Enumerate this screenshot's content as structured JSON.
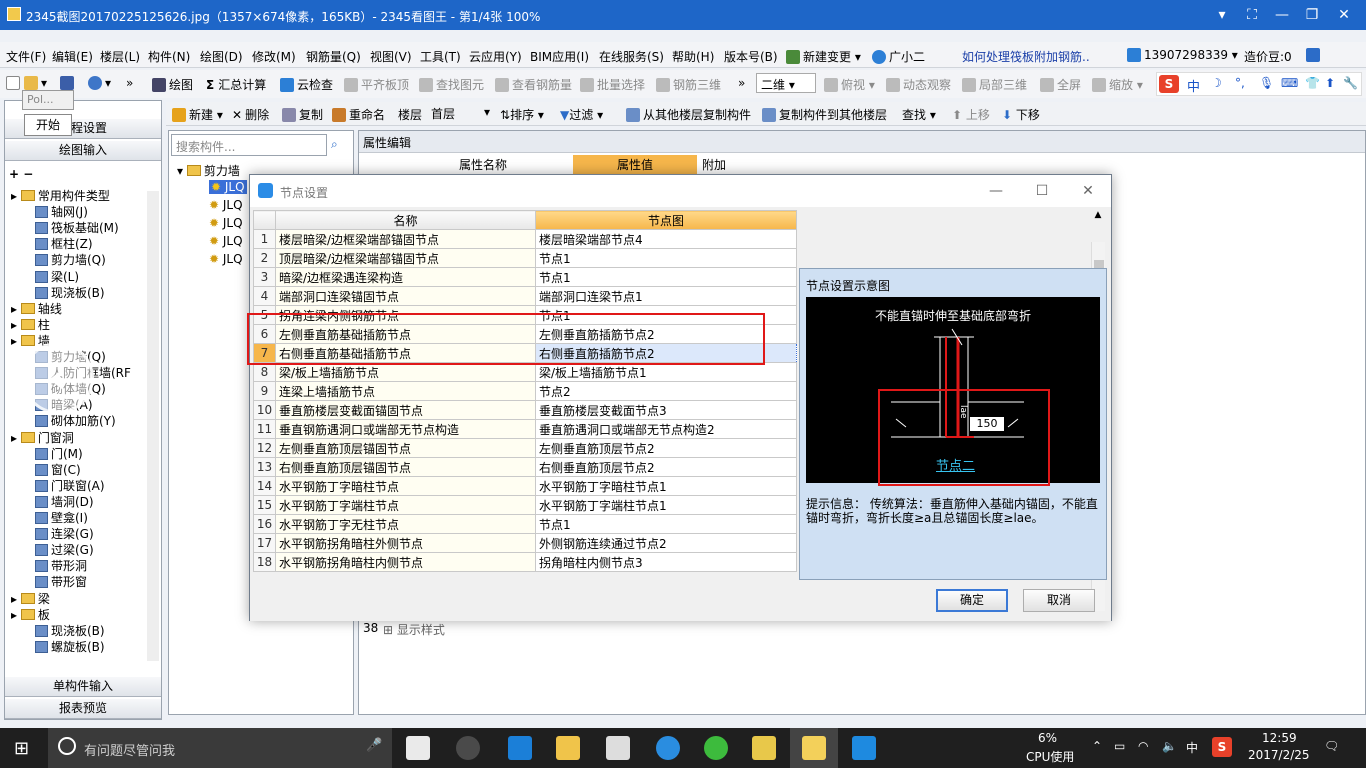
{
  "window": {
    "title": "2345截图20170225125626.jpg（1357×674像素，165KB）- 2345看图王 - 第1/4张 100%"
  },
  "menubar": {
    "items": [
      "文件(F)",
      "编辑(E)",
      "楼层(L)",
      "构件(N)",
      "绘图(D)",
      "修改(M)",
      "钢筋量(Q)",
      "视图(V)",
      "工具(T)",
      "云应用(Y)",
      "BIM应用(I)",
      "在线服务(S)",
      "帮助(H)",
      "版本号(B)"
    ],
    "new_change": "新建变更",
    "assistant": "广小二",
    "help_link": "如何处理筏板附加钢筋..",
    "phone": "13907298339",
    "price": "造价豆:0"
  },
  "toolbar1": {
    "draw": "绘图",
    "sum": "汇总计算",
    "cloud_check": "云检查",
    "flat_top": "平齐板顶",
    "find_element": "查找图元",
    "view_rebar": "查看钢筋量",
    "batch_select": "批量选择",
    "rebar_3d": "钢筋三维",
    "view_mode": "二维",
    "top_view": "俯视",
    "dynamic_view": "动态观察",
    "local_3d": "局部三维",
    "fullscreen": "全屏",
    "zoom": "缩放"
  },
  "toolbar2": {
    "new": "新建",
    "delete": "删除",
    "copy": "复制",
    "rename": "重命名",
    "floor_label": "楼层",
    "floor_value": "首层",
    "sort": "排序",
    "filter": "过滤",
    "copy_from": "从其他楼层复制构件",
    "copy_to": "复制构件到其他楼层",
    "find": "查找",
    "move_up": "上移",
    "move_down": "下移"
  },
  "ime": {
    "lang": "中"
  },
  "left_panel": {
    "start_tooltip": "开始",
    "popup": "Pol...",
    "project_settings": "工程设置",
    "draw_input": "绘图输入",
    "tree": [
      {
        "label": "常用构件类型",
        "folder": true
      },
      {
        "label": "轴网(J)"
      },
      {
        "label": "筏板基础(M)"
      },
      {
        "label": "框柱(Z)"
      },
      {
        "label": "剪力墙(Q)"
      },
      {
        "label": "梁(L)"
      },
      {
        "label": "现浇板(B)"
      },
      {
        "label": "轴线",
        "folder": true
      },
      {
        "label": "柱",
        "folder": true
      },
      {
        "label": "墙",
        "folder": true
      },
      {
        "label": "剪力墙(Q)"
      },
      {
        "label": "人防门框墙(RF"
      },
      {
        "label": "砌体墙(Q)"
      },
      {
        "label": "暗梁(A)"
      },
      {
        "label": "砌体加筋(Y)"
      },
      {
        "label": "门窗洞",
        "folder": true
      },
      {
        "label": "门(M)"
      },
      {
        "label": "窗(C)"
      },
      {
        "label": "门联窗(A)"
      },
      {
        "label": "墙洞(D)"
      },
      {
        "label": "壁龛(I)"
      },
      {
        "label": "连梁(G)"
      },
      {
        "label": "过梁(G)"
      },
      {
        "label": "带形洞"
      },
      {
        "label": "带形窗"
      },
      {
        "label": "梁",
        "folder": true
      },
      {
        "label": "板",
        "folder": true
      },
      {
        "label": "现浇板(B)"
      },
      {
        "label": "螺旋板(B)"
      }
    ],
    "single_input": "单构件输入",
    "report_preview": "报表预览"
  },
  "middle_panel": {
    "search_placeholder": "搜索构件...",
    "root": "剪力墙",
    "children": [
      "JLQ",
      "JLQ",
      "JLQ",
      "JLQ",
      "JLQ"
    ]
  },
  "property_panel": {
    "title": "属性编辑",
    "col_name": "属性名称",
    "col_value": "属性值",
    "col_extra": "附加",
    "row38_index": "38",
    "row38_label": "显示样式"
  },
  "dialog": {
    "title": "节点设置",
    "col_name": "名称",
    "col_node": "节点图",
    "rows": [
      {
        "i": "1",
        "name": "楼层暗梁/边框梁端部锚固节点",
        "node": "楼层暗梁端部节点4"
      },
      {
        "i": "2",
        "name": "顶层暗梁/边框梁端部锚固节点",
        "node": "节点1"
      },
      {
        "i": "3",
        "name": "暗梁/边框梁遇连梁构造",
        "node": "节点1"
      },
      {
        "i": "4",
        "name": "端部洞口连梁锚固节点",
        "node": "端部洞口连梁节点1"
      },
      {
        "i": "5",
        "name": "拐角连梁内侧钢筋节点",
        "node": "节点1"
      },
      {
        "i": "6",
        "name": "左侧垂直筋基础插筋节点",
        "node": "左侧垂直筋插筋节点2"
      },
      {
        "i": "7",
        "name": "右侧垂直筋基础插筋节点",
        "node": "右侧垂直筋插筋节点2"
      },
      {
        "i": "8",
        "name": "梁/板上墙插筋节点",
        "node": "梁/板上墙插筋节点1"
      },
      {
        "i": "9",
        "name": "连梁上墙插筋节点",
        "node": "节点2"
      },
      {
        "i": "10",
        "name": "垂直筋楼层变截面锚固节点",
        "node": "垂直筋楼层变截面节点3"
      },
      {
        "i": "11",
        "name": "垂直钢筋遇洞口或端部无节点构造",
        "node": "垂直筋遇洞口或端部无节点构造2"
      },
      {
        "i": "12",
        "name": "左侧垂直筋顶层锚固节点",
        "node": "左侧垂直筋顶层节点2"
      },
      {
        "i": "13",
        "name": "右侧垂直筋顶层锚固节点",
        "node": "右侧垂直筋顶层节点2"
      },
      {
        "i": "14",
        "name": "水平钢筋丁字暗柱节点",
        "node": "水平钢筋丁字暗柱节点1"
      },
      {
        "i": "15",
        "name": "水平钢筋丁字端柱节点",
        "node": "水平钢筋丁字端柱节点1"
      },
      {
        "i": "16",
        "name": "水平钢筋丁字无柱节点",
        "node": "节点1"
      },
      {
        "i": "17",
        "name": "水平钢筋拐角暗柱外侧节点",
        "node": "外侧钢筋连续通过节点2"
      },
      {
        "i": "18",
        "name": "水平钢筋拐角暗柱内侧节点",
        "node": "拐角暗柱内侧节点3"
      }
    ],
    "preview_caption": "节点设置示意图",
    "diagram_title": "不能直锚时伸至基础底部弯折",
    "diagram_dim": "150",
    "diagram_lae": "lae",
    "diagram_node": "节点二",
    "hint_label": "提示信息：",
    "hint_text": "传统算法：垂直筋伸入基础内锚固，不能直锚时弯折，弯折长度≥a且总锚固长度≥lae。",
    "ok": "确定",
    "cancel": "取消"
  },
  "taskbar": {
    "search_placeholder": "有问题尽管问我",
    "cpu_percent": "6%",
    "cpu_label": "CPU使用",
    "ime": "中",
    "time": "12:59",
    "date": "2017/2/25"
  },
  "colors": {
    "titlebar": "#1e66c8",
    "highlight": "#e01818",
    "header_orange": "#f6b64b",
    "diagram_red": "#e01818"
  }
}
